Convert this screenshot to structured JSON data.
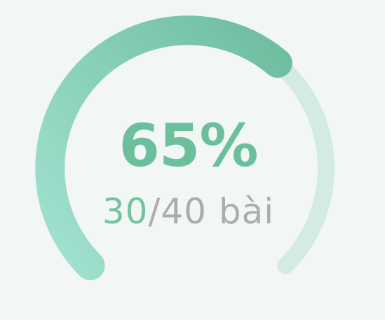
{
  "progress": {
    "percent_text": "65%",
    "completed": "30",
    "separator": "/",
    "total": "40",
    "unit": " bài",
    "fraction": 0.65
  },
  "colors": {
    "background": "#f2f7f5",
    "arc_fill_start": "#a3e2d1",
    "arc_fill_end": "#6dbd9f",
    "arc_track": "#d3ebe3",
    "percent_text": "#6cbf9d",
    "completed_text": "#74c3a0",
    "muted_text": "#a9aeac"
  }
}
